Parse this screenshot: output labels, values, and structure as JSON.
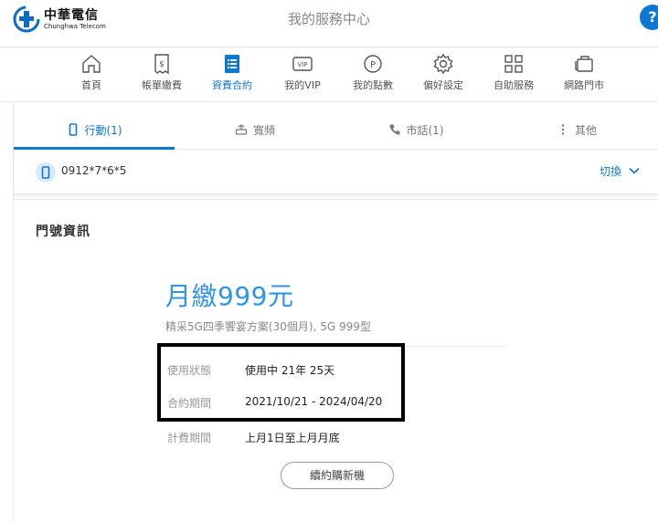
{
  "header": {
    "logo_cn": "中華電信",
    "logo_en": "Chunghwa Telecom",
    "title": "我的服務中心"
  },
  "nav": {
    "items": [
      {
        "label": "首頁",
        "icon": "home-icon"
      },
      {
        "label": "帳單繳費",
        "icon": "bill-icon"
      },
      {
        "label": "資費合約",
        "icon": "contract-icon",
        "active": true
      },
      {
        "label": "我的VIP",
        "icon": "vip-icon"
      },
      {
        "label": "我的點數",
        "icon": "points-icon"
      },
      {
        "label": "偏好設定",
        "icon": "gear-icon"
      },
      {
        "label": "自助服務",
        "icon": "grid-icon"
      },
      {
        "label": "網路門市",
        "icon": "shop-icon"
      }
    ]
  },
  "tabs": [
    {
      "label": "行動(1)",
      "icon": "mobile-icon",
      "active": true
    },
    {
      "label": "寬頻",
      "icon": "router-icon"
    },
    {
      "label": "市話(1)",
      "icon": "phone-icon"
    },
    {
      "label": "其他",
      "icon": "more-icon"
    }
  ],
  "phone": {
    "number": "0912*7*6*5",
    "switch_label": "切換"
  },
  "card": {
    "title": "門號資訊",
    "price": "月繳999元",
    "plan": "精采5G四季饗宴方案(30個月), 5G 999型",
    "rows": [
      {
        "label": "使用狀態",
        "value": "使用中 21年 25天"
      },
      {
        "label": "合約期間",
        "value": "2021/10/21 - 2024/04/20"
      },
      {
        "label": "計費期間",
        "value": "上月1日至上月月底"
      }
    ],
    "renew_button": "續約購新機"
  },
  "colors": {
    "brand_blue": "#0d78d3",
    "price_blue": "#2e95e6",
    "text_muted": "#999999"
  }
}
